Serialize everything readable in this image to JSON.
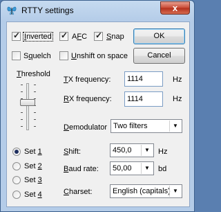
{
  "window": {
    "title": "RTTY settings",
    "close_glyph": "x"
  },
  "checkboxes": {
    "inverted": {
      "label_pre": "",
      "label_u": "I",
      "label_post": "nverted",
      "checked": true
    },
    "afc": {
      "label_pre": "A",
      "label_u": "F",
      "label_post": "C",
      "checked": true
    },
    "snap": {
      "label_pre": "",
      "label_u": "S",
      "label_post": "nap",
      "checked": true
    },
    "squelch": {
      "label_pre": "S",
      "label_u": "q",
      "label_post": "uelch",
      "checked": false
    },
    "unshift": {
      "label_pre": "",
      "label_u": "U",
      "label_post": "nshift on space",
      "checked": false
    }
  },
  "buttons": {
    "ok": "OK",
    "cancel": "Cancel"
  },
  "threshold": {
    "label_pre": "",
    "label_u": "T",
    "label_post": "hreshold",
    "level": 0.6
  },
  "tx_frequency": {
    "label_pre": "",
    "label_u": "T",
    "label_post": "X frequency:",
    "value": "1114",
    "unit": "Hz"
  },
  "rx_frequency": {
    "label_pre": "",
    "label_u": "R",
    "label_post": "X frequency:",
    "value": "1114",
    "unit": "Hz"
  },
  "demodulator": {
    "label_pre": "",
    "label_u": "D",
    "label_post": "emodulator",
    "value": "Two filters"
  },
  "shift": {
    "label_pre": "",
    "label_u": "S",
    "label_post": "hift:",
    "value": "450,0",
    "unit": "Hz"
  },
  "baud_rate": {
    "label_pre": "",
    "label_u": "B",
    "label_post": "aud rate:",
    "value": "50,00",
    "unit": "bd"
  },
  "charset": {
    "label_pre": "",
    "label_u": "C",
    "label_post": "harset:",
    "value": "English (capitals)"
  },
  "sets": [
    {
      "label_pre": "Set ",
      "label_u": "1",
      "selected": true
    },
    {
      "label_pre": "Set ",
      "label_u": "2",
      "selected": false
    },
    {
      "label_pre": "Set ",
      "label_u": "3",
      "selected": false
    },
    {
      "label_pre": "Set ",
      "label_u": "4",
      "selected": false
    }
  ],
  "icons": {
    "app": "butterfly-icon",
    "close": "close-icon",
    "dropdown": "chevron-down-icon"
  }
}
